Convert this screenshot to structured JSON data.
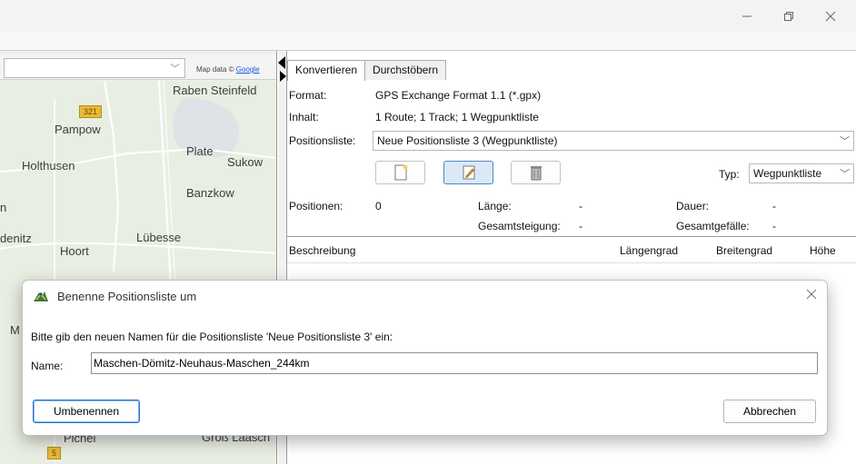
{
  "map": {
    "copyright_prefix": "Map data ©",
    "copyright_link": "Google",
    "labels": [
      "Raben Steinfeld",
      "Pampow",
      "Holthusen",
      "Plate",
      "Sukow",
      "Banzkow",
      "Hoort",
      "Lübesse",
      "Pichel",
      "Groß Laasch",
      "denitz",
      "n",
      "M"
    ],
    "road_badges": [
      "321",
      "5"
    ]
  },
  "tabs": [
    "Konvertieren",
    "Durchstöbern"
  ],
  "properties": {
    "format_label": "Format:",
    "format_value": "GPS Exchange Format 1.1 (*.gpx)",
    "content_label": "Inhalt:",
    "content_value": "1 Route; 1 Track; 1 Wegpunktliste",
    "poslist_label": "Positionsliste:",
    "poslist_value": "Neue Positionsliste 3 (Wegpunktliste)",
    "type_label": "Typ:",
    "type_value": "Wegpunktliste"
  },
  "stats": {
    "positions_label": "Positionen:",
    "positions_value": "0",
    "length_label": "Länge:",
    "length_value": "-",
    "duration_label": "Dauer:",
    "duration_value": "-",
    "ascent_label": "Gesamtsteigung:",
    "ascent_value": "-",
    "descent_label": "Gesamtgefälle:",
    "descent_value": "-"
  },
  "columns": [
    "Beschreibung",
    "Längengrad",
    "Breitengrad",
    "Höhe"
  ],
  "dialog": {
    "title": "Benenne Positionsliste um",
    "prompt": "Bitte gib den neuen Namen für die Positionsliste 'Neue Positionsliste 3' ein:",
    "name_label": "Name:",
    "name_value": "Maschen-Dömitz-Neuhaus-Maschen_244km",
    "ok_label": "Umbenennen",
    "cancel_label": "Abbrechen"
  },
  "colors": {
    "accent": "#2f73c6",
    "map_bg": "#e9eee3",
    "road_badge": "#e8b93a",
    "water": "#dfe3e8"
  }
}
